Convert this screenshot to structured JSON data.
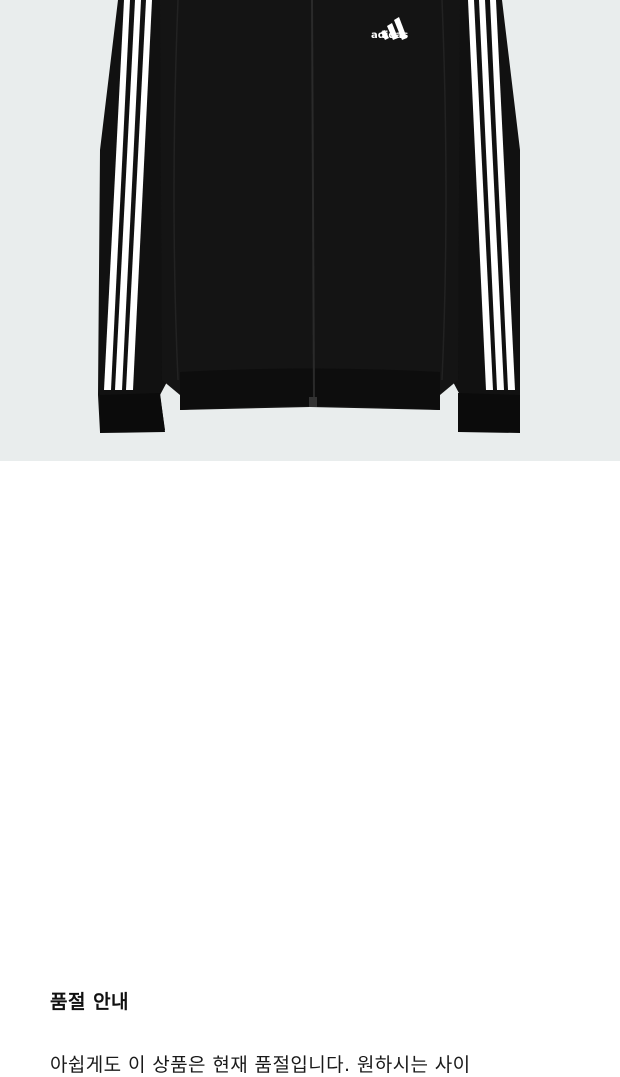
{
  "product": {
    "brand_logo_text": "adidas",
    "colors": {
      "background": "#e9eded",
      "jacket": "#111111",
      "stripes": "#ffffff"
    }
  },
  "sold_out_notice": {
    "title": "품절 안내",
    "message": "아쉽게도 이 상품은 현재 품절입니다. 원하시는 사이"
  }
}
